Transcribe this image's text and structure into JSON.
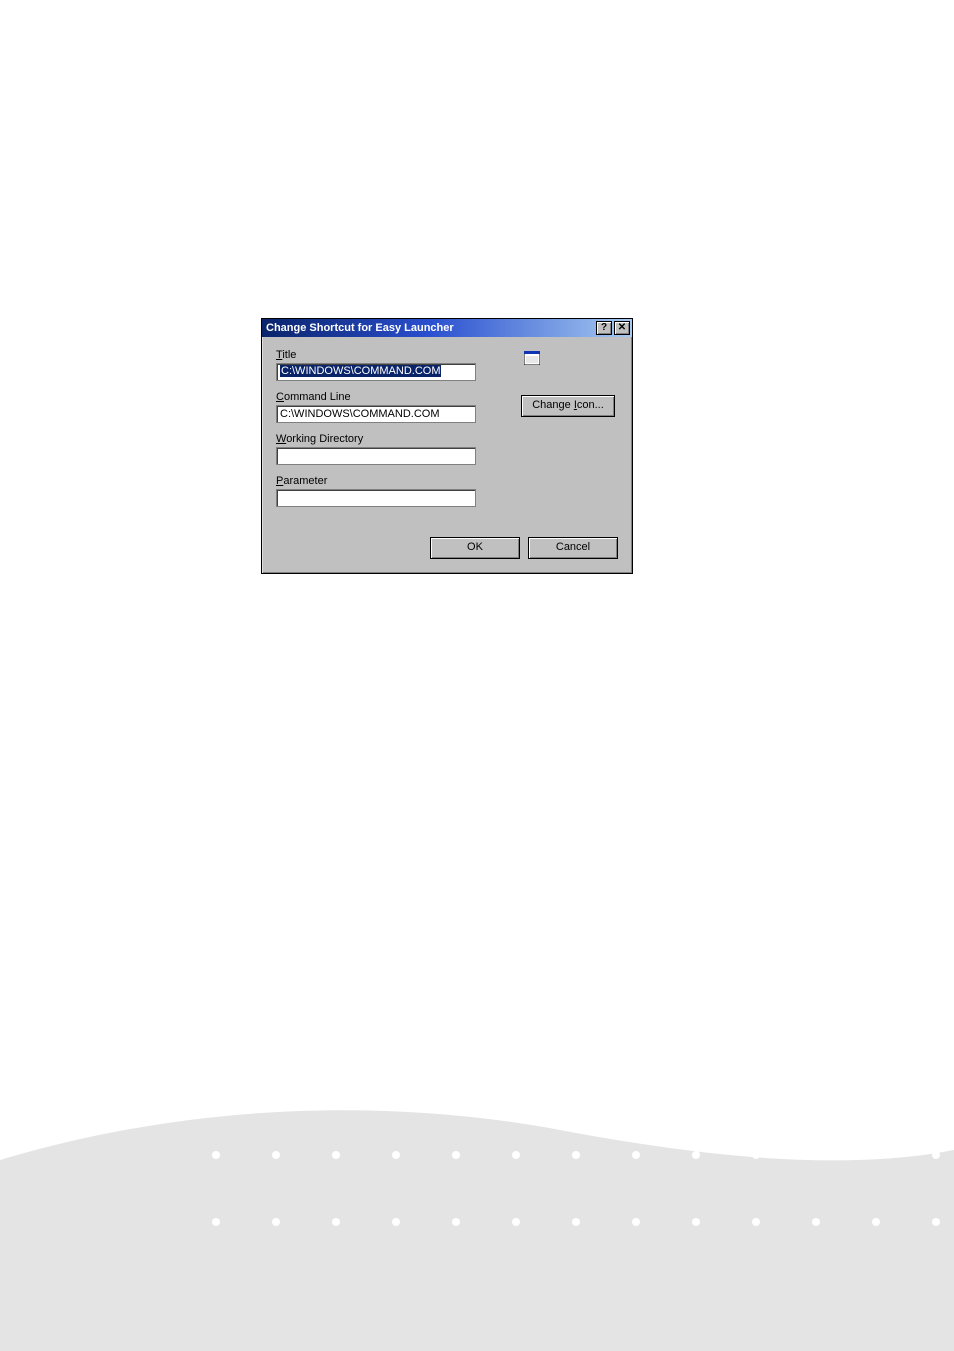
{
  "dialog": {
    "title": "Change Shortcut for Easy Launcher",
    "fields": {
      "title": {
        "label_pre": "T",
        "label_post": "itle",
        "value": "C:\\WINDOWS\\COMMAND.COM"
      },
      "command": {
        "label_pre": "C",
        "label_post": "ommand Line",
        "value": "C:\\WINDOWS\\COMMAND.COM"
      },
      "workdir": {
        "label_pre": "W",
        "label_post": "orking Directory",
        "value": ""
      },
      "param": {
        "label_pre": "P",
        "label_post": "arameter",
        "value": ""
      }
    },
    "buttons": {
      "change_icon_pre": "Change ",
      "change_icon_ul": "I",
      "change_icon_post": "con...",
      "ok": "OK",
      "cancel": "Cancel"
    }
  }
}
